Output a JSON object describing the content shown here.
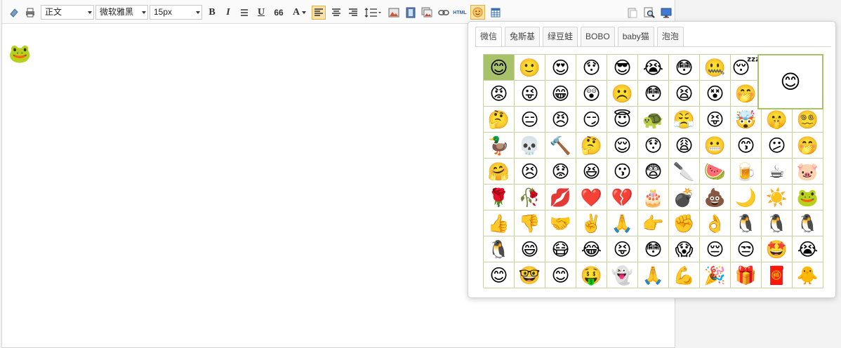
{
  "toolbar": {
    "format_select": "正文",
    "font_select": "微软雅黑",
    "size_select": "15px",
    "bold_label": "B",
    "italic_label": "I",
    "underline_label": "U",
    "quote_label": "66",
    "fontcolor_label": "A",
    "html_label": "HTML"
  },
  "editor": {
    "inserted_emoji": "🐸"
  },
  "emoji_popup": {
    "tabs": [
      "微信",
      "兔斯基",
      "绿豆蛙",
      "BOBO",
      "baby猫",
      "泡泡"
    ],
    "active_tab": "微信",
    "preview": "😊",
    "rows": [
      [
        "😊",
        "🙂",
        "😍",
        "😯",
        "😎",
        "😭",
        "😳",
        "🤐",
        "😴",
        "",
        ""
      ],
      [
        "😡",
        "😜",
        "😁",
        "😲",
        "☹️",
        "😳",
        "😫",
        "😵",
        "🤭",
        "",
        ""
      ],
      [
        "🤔",
        "😑",
        "😠",
        "😏",
        "😇",
        "🐢",
        "😤",
        "😝",
        "🤯",
        "🤫",
        "😵‍💫"
      ],
      [
        "🦆",
        "💀",
        "🔨",
        "🤔",
        "😌",
        "😯",
        "😩",
        "😬",
        "😙",
        "😕",
        "🤭"
      ],
      [
        "🤗",
        "😣",
        "😟",
        "😆",
        "😗",
        "😨",
        "🔪",
        "🍉",
        "🍺",
        "☕",
        "🐷"
      ],
      [
        "🌹",
        "🥀",
        "💋",
        "❤️",
        "💔",
        "🎂",
        "💣",
        "💩",
        "🌙",
        "☀️",
        "🐸"
      ],
      [
        "👍",
        "👎",
        "🤝",
        "✌️",
        "🙏",
        "👉",
        "✊",
        "👌",
        "🐧",
        "🐧",
        "🐧"
      ],
      [
        "🐧",
        "😄",
        "😷",
        "😂",
        "😝",
        "😳",
        "😱",
        "😔",
        "😒",
        "🤩",
        "😭"
      ],
      [
        "😊",
        "🤓",
        "😊",
        "🤑",
        "👻",
        "🙏",
        "💪",
        "🎉",
        "🎁",
        "🧧",
        "🐥"
      ]
    ]
  }
}
